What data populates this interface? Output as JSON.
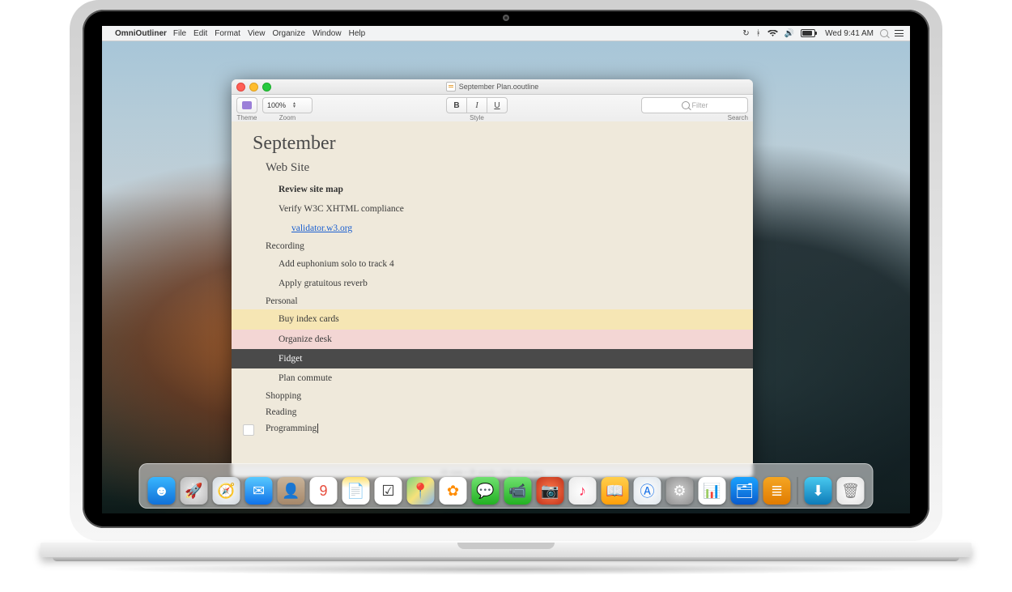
{
  "menubar": {
    "app_name": "OmniOutliner",
    "items": [
      "File",
      "Edit",
      "Format",
      "View",
      "Organize",
      "Window",
      "Help"
    ],
    "clock": "Wed 9:41 AM"
  },
  "window": {
    "title": "September Plan.ooutline",
    "toolbar": {
      "theme_label": "Theme",
      "zoom_label": "Zoom",
      "zoom_value": "100%",
      "style_label": "Style",
      "style_buttons": {
        "bold": "B",
        "italic": "I",
        "underline": "U"
      },
      "search_label": "Search",
      "search_placeholder": "Filter"
    },
    "document": {
      "title": "September",
      "sections": [
        {
          "heading": "Web Site",
          "rows": [
            {
              "text": "Review site map",
              "level": 2,
              "bold": true
            },
            {
              "text": "Verify W3C XHTML compliance",
              "level": 2
            },
            {
              "text": "validator.w3.org",
              "level": 3,
              "link": true
            }
          ]
        },
        {
          "heading": "Recording",
          "rows": [
            {
              "text": "Add euphonium solo to track 4",
              "level": 2
            },
            {
              "text": "Apply gratuitous reverb",
              "level": 2
            }
          ]
        },
        {
          "heading": "Personal",
          "rows": [
            {
              "text": "Buy index cards",
              "level": 2,
              "highlight": "yellow"
            },
            {
              "text": "Organize desk",
              "level": 2,
              "highlight": "pink"
            },
            {
              "text": "Fidget",
              "level": 2,
              "highlight": "selected"
            },
            {
              "text": "Plan commute",
              "level": 2
            }
          ]
        },
        {
          "heading": "Shopping",
          "rows": []
        },
        {
          "heading": "Reading",
          "rows": []
        },
        {
          "heading": "Programming",
          "rows": [],
          "cursor": true,
          "grip": true
        }
      ]
    },
    "status": "16 rows • 35 words • 216 characters"
  },
  "dock": {
    "apps": [
      {
        "name": "finder",
        "color": "linear-gradient(to bottom,#38b6ff,#1171d8)",
        "glyph": "☻"
      },
      {
        "name": "launchpad",
        "color": "radial-gradient(circle,#efefef,#b8b8b8)",
        "glyph": "🚀"
      },
      {
        "name": "safari",
        "color": "radial-gradient(circle,#fefefe,#cfd6dc)",
        "glyph": "🧭"
      },
      {
        "name": "mail",
        "color": "linear-gradient(to bottom,#57c9ff,#1172e8)",
        "glyph": "✉"
      },
      {
        "name": "contacts",
        "color": "linear-gradient(to bottom,#c9b49a,#a6886a)",
        "glyph": "👤"
      },
      {
        "name": "calendar",
        "color": "#fff",
        "glyph": "9",
        "text_color": "#e74c3c"
      },
      {
        "name": "notes",
        "color": "linear-gradient(to bottom,#ffe16b,#fefefe 40%)",
        "glyph": "📄"
      },
      {
        "name": "reminders",
        "color": "#fff",
        "glyph": "☑",
        "text_color": "#333"
      },
      {
        "name": "maps",
        "color": "linear-gradient(135deg,#7fd17f,#f6e27a,#87b6ef)",
        "glyph": "📍"
      },
      {
        "name": "photos",
        "color": "#fff",
        "glyph": "✿",
        "text_color": "#ff8c00"
      },
      {
        "name": "messages",
        "color": "linear-gradient(to bottom,#6fe06f,#23b123)",
        "glyph": "💬"
      },
      {
        "name": "facetime",
        "color": "linear-gradient(to bottom,#6fe06f,#23b123)",
        "glyph": "📹"
      },
      {
        "name": "photobooth",
        "color": "radial-gradient(circle,#ff7b4d,#c0321a)",
        "glyph": "📷"
      },
      {
        "name": "itunes",
        "color": "radial-gradient(circle,#ffffff,#e9e9e9)",
        "glyph": "♪",
        "text_color": "#ff2d55"
      },
      {
        "name": "ibooks",
        "color": "linear-gradient(to bottom,#ffcf4b,#ff9f0a)",
        "glyph": "📖"
      },
      {
        "name": "appstore",
        "color": "radial-gradient(circle,#ffffff,#dfe6ec)",
        "glyph": "Ⓐ",
        "text_color": "#1a73e8"
      },
      {
        "name": "preferences",
        "color": "radial-gradient(circle,#d0d0d0,#8c8c8c)",
        "glyph": "⚙"
      },
      {
        "name": "numbers",
        "color": "#ffffff",
        "glyph": "📊",
        "text_color": "#27ae60"
      },
      {
        "name": "keynote",
        "color": "linear-gradient(to bottom,#1aa3ff,#0a5bcc)",
        "glyph": "🗂"
      },
      {
        "name": "omnioutliner",
        "color": "linear-gradient(to bottom,#f5a623,#e07b00)",
        "glyph": "≣"
      }
    ],
    "right": [
      {
        "name": "downloads",
        "color": "linear-gradient(to bottom,#48c9ef,#0e7bb8)",
        "glyph": "⬇"
      },
      {
        "name": "trash",
        "color": "radial-gradient(circle,#ffffff,#e2e2e2)",
        "glyph": "🗑",
        "text_color": "#888"
      }
    ]
  }
}
